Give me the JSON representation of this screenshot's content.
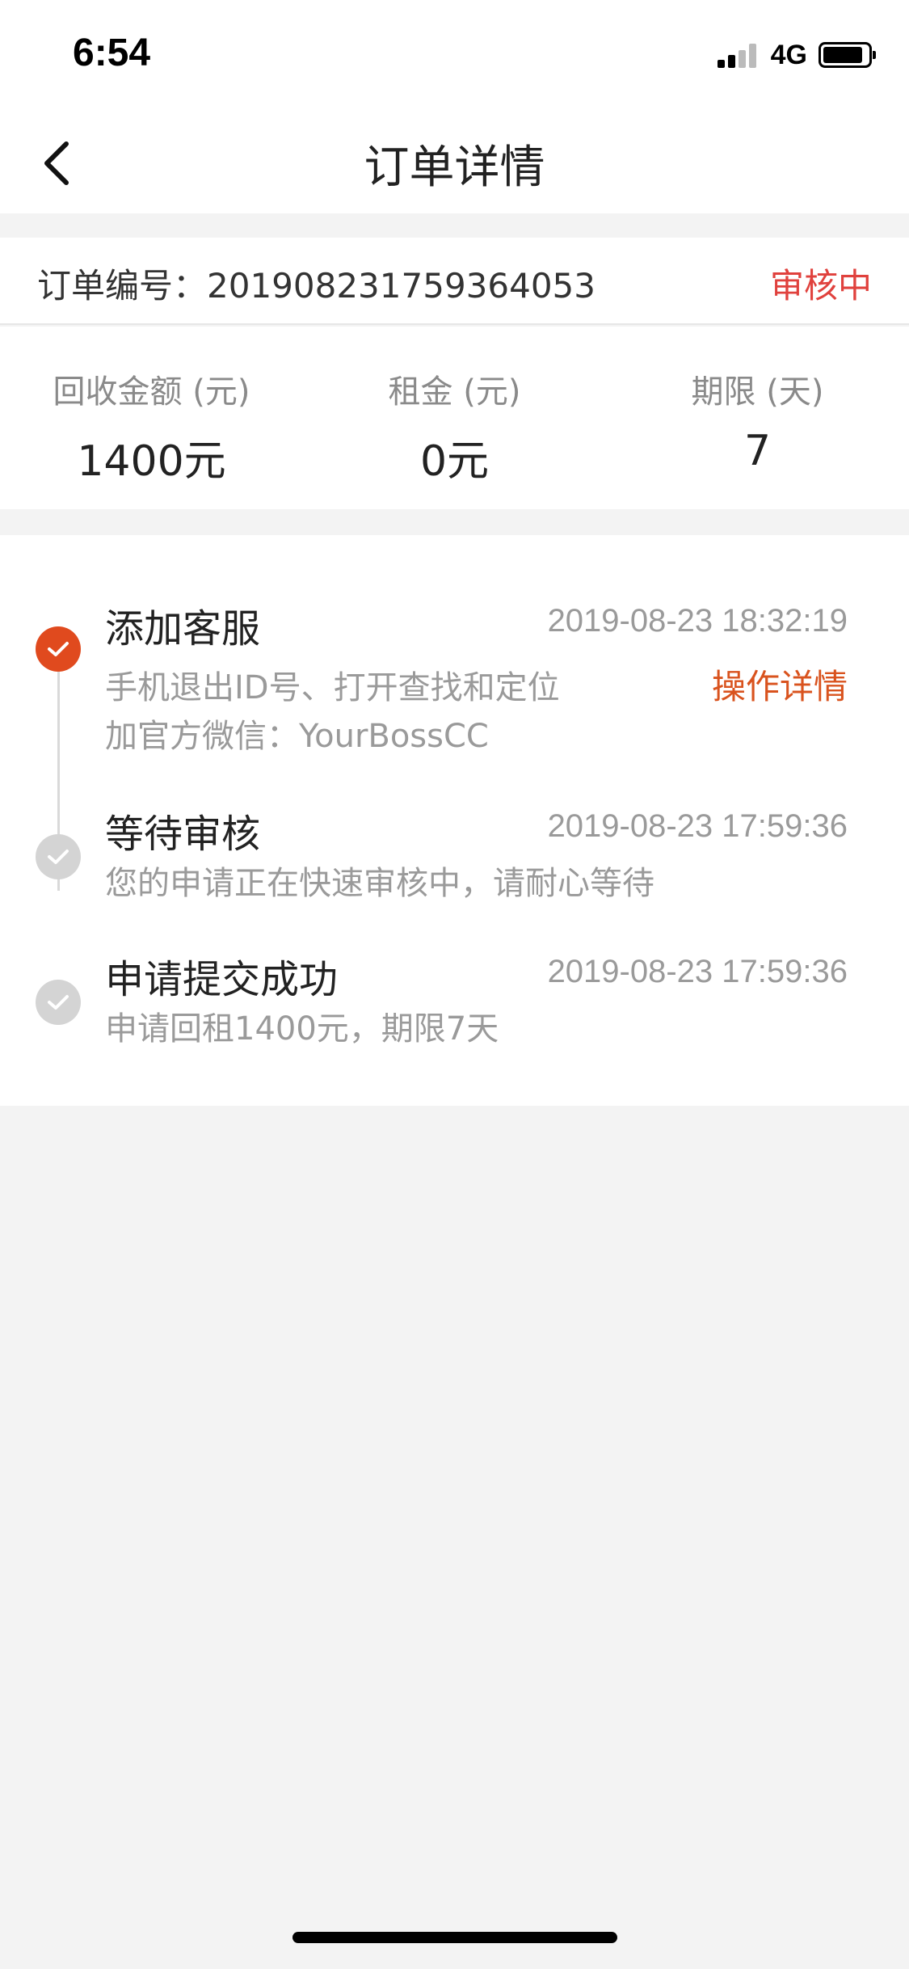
{
  "status_bar": {
    "time": "6:54",
    "network": "4G"
  },
  "nav": {
    "title": "订单详情",
    "back_icon": "chevron-left-icon"
  },
  "order": {
    "number_label": "订单编号：201908231759364053",
    "status": "审核中",
    "status_color": "#e0413d"
  },
  "summary": [
    {
      "label": "回收金额 (元)",
      "value": "1400元"
    },
    {
      "label": "租金 (元)",
      "value": "0元"
    },
    {
      "label": "期限 (天)",
      "value": "7"
    }
  ],
  "timeline": [
    {
      "title": "添加客服",
      "time": "2019-08-23 18:32:19",
      "desc_lines": [
        "手机退出ID号、打开查找和定位",
        "加官方微信：YourBossCC"
      ],
      "link": "操作详情",
      "active": true,
      "icon": "check-icon"
    },
    {
      "title": "等待审核",
      "time": "2019-08-23 17:59:36",
      "desc_lines": [
        "您的申请正在快速审核中，请耐心等待"
      ],
      "active": false,
      "icon": "check-icon"
    },
    {
      "title": "申请提交成功",
      "time": "2019-08-23 17:59:36",
      "desc_lines": [
        "申请回租1400元，期限7天"
      ],
      "active": false,
      "icon": "check-icon"
    }
  ],
  "colors": {
    "accent": "#d9531e",
    "active_dot": "#e04a1e",
    "inactive_dot": "#d4d4d4"
  }
}
